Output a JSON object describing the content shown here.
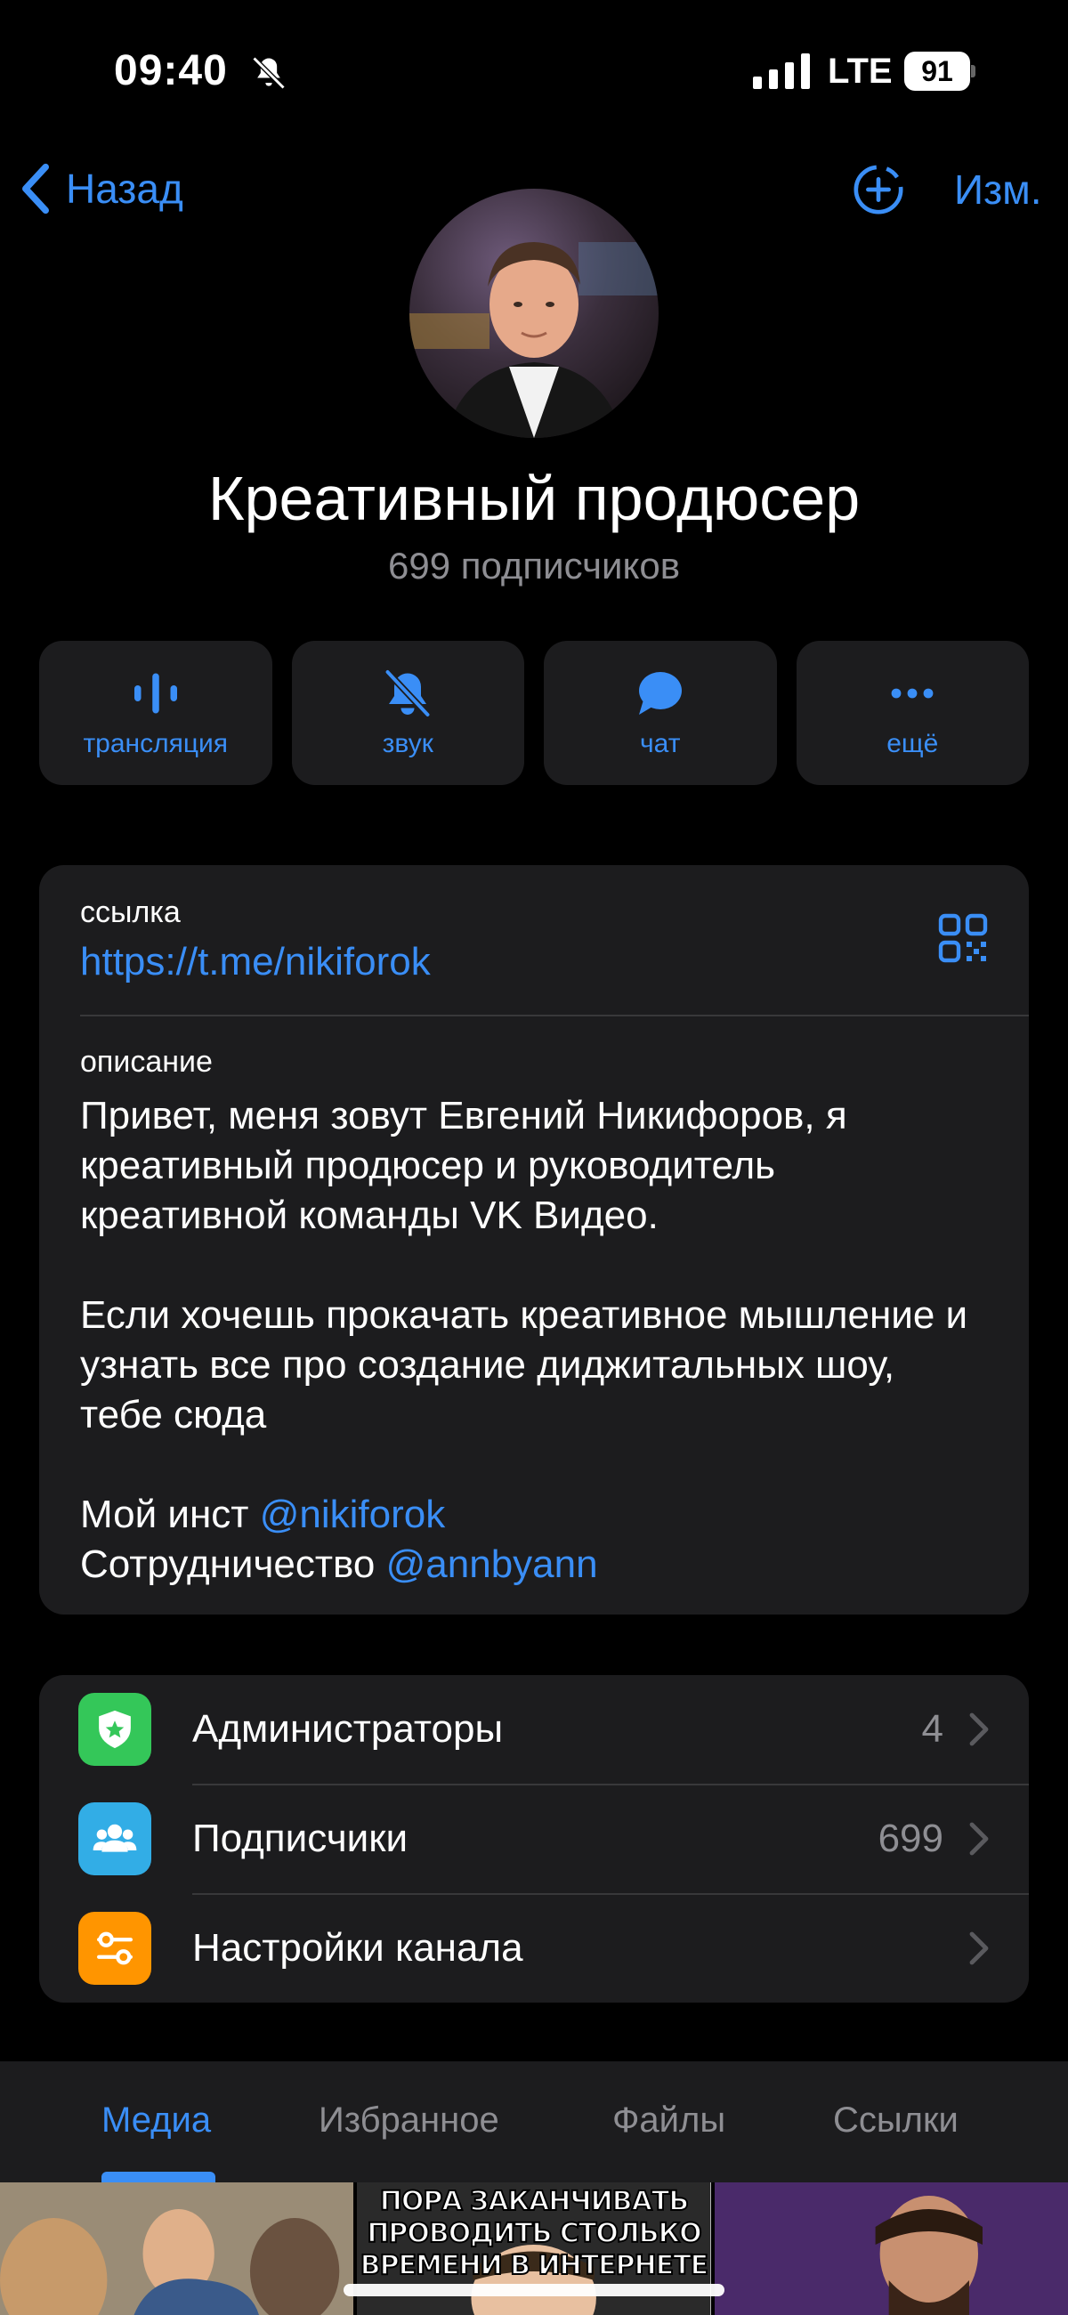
{
  "status_bar": {
    "time": "09:40",
    "network": "LTE",
    "battery": "91"
  },
  "nav": {
    "back_label": "Назад",
    "edit_label": "Изм."
  },
  "channel": {
    "title": "Креативный продюсер",
    "subscribers": "699 подписчиков"
  },
  "actions": [
    {
      "label": "трансляция",
      "icon": "broadcast-icon"
    },
    {
      "label": "звук",
      "icon": "bell-off-icon"
    },
    {
      "label": "чат",
      "icon": "chat-bubble-icon"
    },
    {
      "label": "ещё",
      "icon": "more-dots-icon"
    }
  ],
  "info": {
    "link_label": "ссылка",
    "link_url": "https://t.me/nikiforok",
    "description_label": "описание",
    "description_p1": "Привет, меня зовут Евгений Никифоров, я креативный продюсер и руководитель креативной команды VK Видео.",
    "description_p2": "Если хочешь прокачать креативное мышление и узнать все про создание диджитальных шоу, тебе сюда",
    "insta_prefix": "Мой инст ",
    "insta_handle": "@nikiforok",
    "collab_prefix": "Сотрудничество ",
    "collab_handle": "@annbyann"
  },
  "settings": [
    {
      "label": "Администраторы",
      "count": "4",
      "icon": "admin-badge-icon",
      "color": "#34c759"
    },
    {
      "label": "Подписчики",
      "count": "699",
      "icon": "people-icon",
      "color": "#32ade6"
    },
    {
      "label": "Настройки канала",
      "count": "",
      "icon": "sliders-icon",
      "color": "#ff9500"
    }
  ],
  "tabs": [
    {
      "label": "Медиа",
      "active": true
    },
    {
      "label": "Избранное",
      "active": false
    },
    {
      "label": "Файлы",
      "active": false
    },
    {
      "label": "Ссылки",
      "active": false
    }
  ],
  "media": {
    "meme_caption": "ПОРА ЗАКАНЧИВАТЬ ПРОВОДИТЬ СТОЛЬКО ВРЕМЕНИ В ИНТЕРНЕТЕ"
  },
  "colors": {
    "accent": "#3a8ef6",
    "background": "#000000",
    "card": "#1c1c1e",
    "secondary_text": "#8e8e93"
  }
}
